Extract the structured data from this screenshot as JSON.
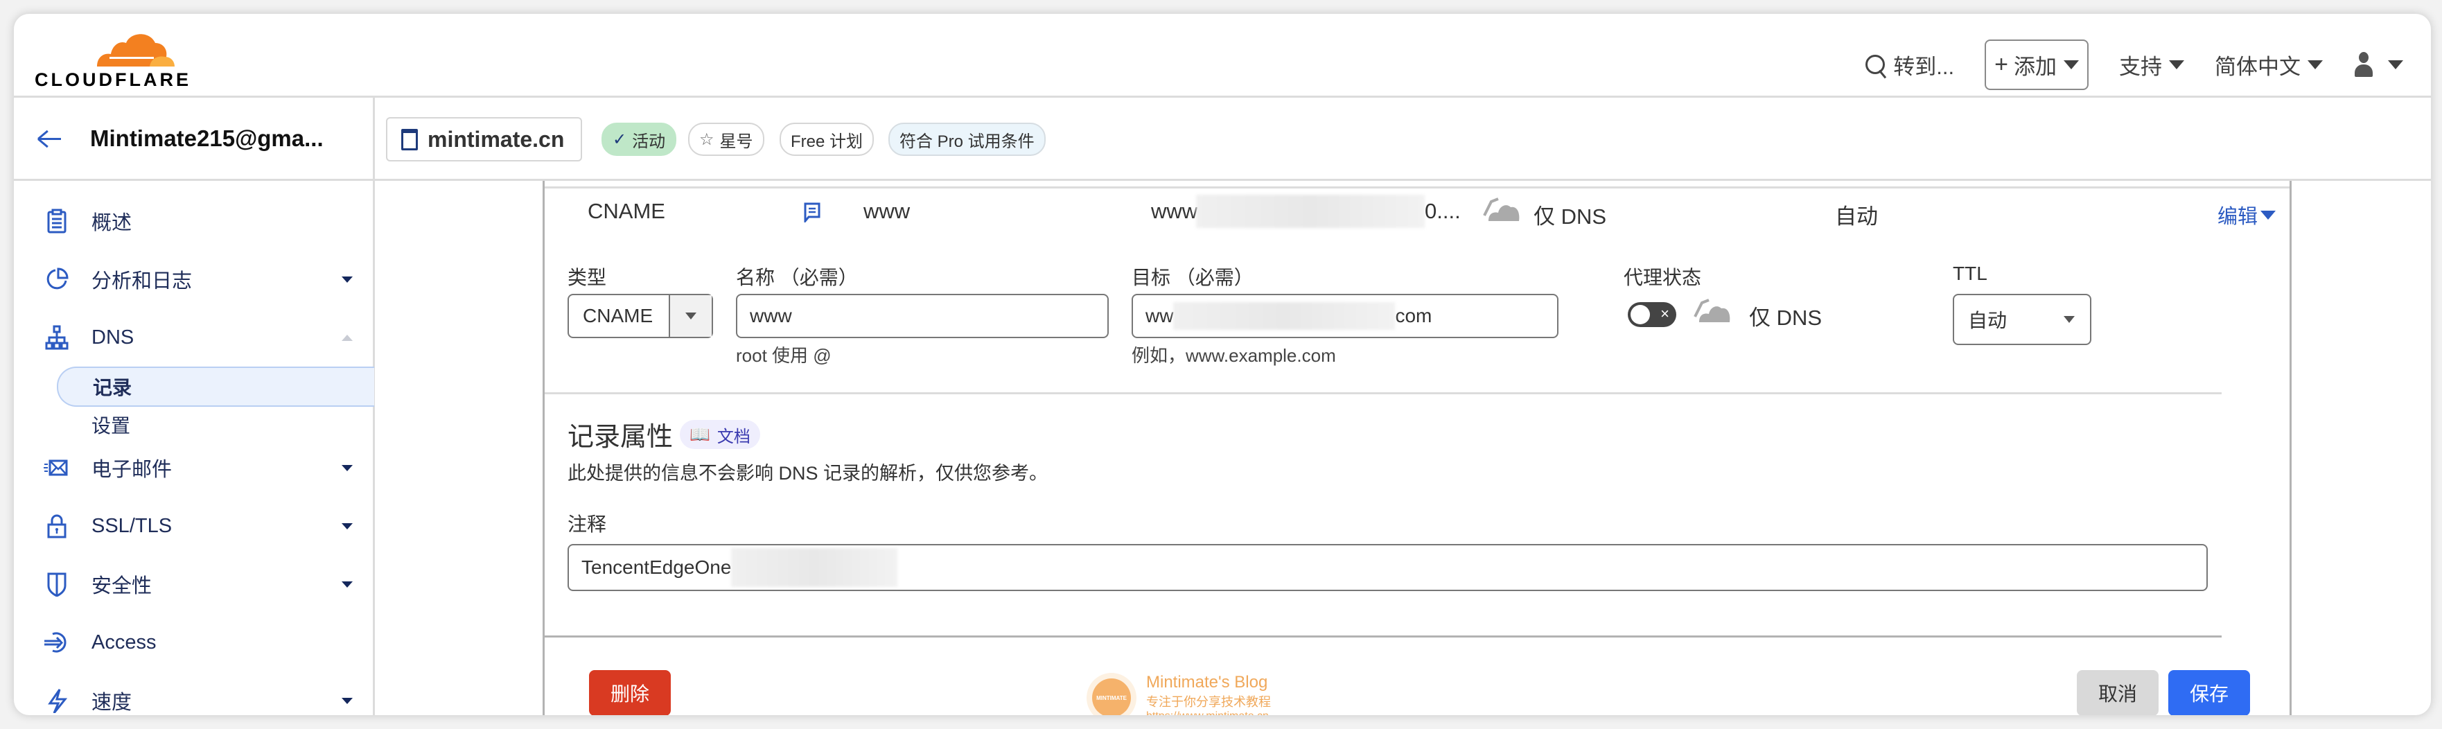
{
  "header": {
    "brand": "CLOUDFLARE",
    "nav": {
      "goto": "转到...",
      "add": "添加",
      "support": "支持",
      "language": "简体中文"
    }
  },
  "sidebar": {
    "account": "Mintimate215@gma...",
    "items": [
      {
        "label": "概述",
        "icon": "clipboard-icon",
        "expandable": false
      },
      {
        "label": "分析和日志",
        "icon": "pie-chart-icon",
        "expandable": true
      },
      {
        "label": "DNS",
        "icon": "network-icon",
        "expandable": true,
        "expanded": true
      },
      {
        "label": "电子邮件",
        "icon": "email-icon",
        "expandable": true
      },
      {
        "label": "SSL/TLS",
        "icon": "lock-icon",
        "expandable": true
      },
      {
        "label": "安全性",
        "icon": "shield-icon",
        "expandable": true
      },
      {
        "label": "Access",
        "icon": "access-icon",
        "expandable": false
      },
      {
        "label": "速度",
        "icon": "lightning-icon",
        "expandable": true
      }
    ],
    "dns_sub": [
      {
        "label": "记录",
        "active": true
      },
      {
        "label": "设置",
        "active": false
      }
    ]
  },
  "zone": {
    "domain": "mintimate.cn",
    "badges": [
      "活动",
      "星号",
      "Free 计划",
      "符合 Pro 试用条件"
    ]
  },
  "record_row": {
    "type": "CNAME",
    "name": "www",
    "content_prefix": "www",
    "content_suffix": "0....",
    "proxy": "仅 DNS",
    "ttl": "自动",
    "edit": "编辑"
  },
  "form": {
    "type_label": "类型",
    "type_value": "CNAME",
    "name_label": "名称 （必需）",
    "name_value": "www",
    "name_hint": "root 使用 @",
    "target_label": "目标 （必需）",
    "target_prefix": "ww",
    "target_suffix": "com",
    "target_hint": "例如，www.example.com",
    "proxy_label": "代理状态",
    "proxy_value": "仅 DNS",
    "ttl_label": "TTL",
    "ttl_value": "自动"
  },
  "attributes": {
    "title": "记录属性",
    "doc_badge": "文档",
    "description": "此处提供的信息不会影响 DNS 记录的解析，仅供您参考。",
    "comment_label": "注释",
    "comment_value": "TencentEdgeOne"
  },
  "actions": {
    "delete": "删除",
    "cancel": "取消",
    "save": "保存"
  },
  "watermark": {
    "title": "Mintimate's Blog",
    "subtitle": "专注于你分享技术教程",
    "url": "https://www.mintimate.cn",
    "logo_text": "MINTIMATE"
  }
}
